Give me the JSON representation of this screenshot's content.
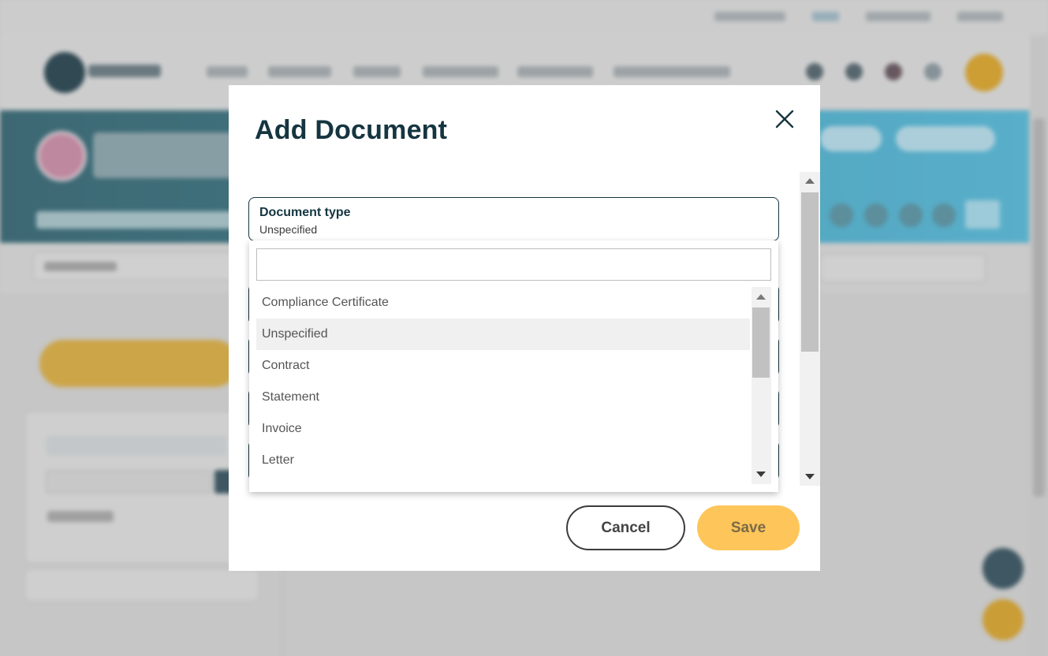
{
  "modal": {
    "title": "Add Document",
    "document_type": {
      "label": "Document type",
      "value": "Unspecified"
    },
    "dropdown": {
      "search_value": "",
      "options": [
        {
          "label": "Compliance Certificate",
          "selected": false
        },
        {
          "label": "Unspecified",
          "selected": true
        },
        {
          "label": "Contract",
          "selected": false
        },
        {
          "label": "Statement",
          "selected": false
        },
        {
          "label": "Invoice",
          "selected": false
        },
        {
          "label": "Letter",
          "selected": false
        }
      ]
    },
    "buttons": {
      "cancel": "Cancel",
      "save": "Save"
    }
  },
  "icons": {
    "close": "close-icon"
  },
  "colors": {
    "title": "#153540",
    "save_button": "#fec55a",
    "selected_option": "#f0f0f0"
  }
}
